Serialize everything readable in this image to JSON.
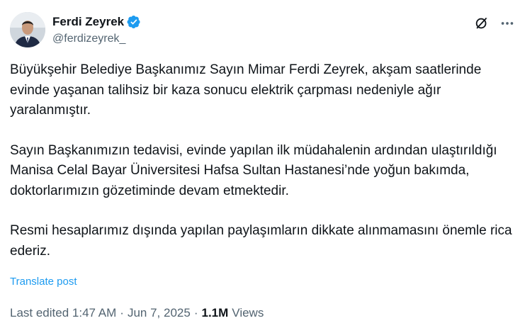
{
  "author": {
    "display_name": "Ferdi Zeyrek",
    "handle": "@ferdizeyrek_",
    "verified": true,
    "verified_color": "#1d9bf0"
  },
  "header_icons": [
    "grok-icon",
    "more-icon"
  ],
  "post": {
    "paragraphs": [
      "Büyükşehir Belediye Başkanımız Sayın Mimar Ferdi Zeyrek, akşam saatlerinde evinde yaşanan talihsiz bir kaza sonucu elektrik çarpması nedeniyle ağır yaralanmıştır.",
      "Sayın Başkanımızın tedavisi, evinde yapılan ilk müdahalenin ardından ulaştırıldığı Manisa Celal Bayar Üniversitesi Hafsa Sultan Hastanesi’nde yoğun bakımda, doktorlarımızın gözetiminde devam etmektedir.",
      "Resmi hesaplarımız dışında yapılan paylaşımların dikkate alınmamasını önemle rica ederiz."
    ],
    "translate_label": "Translate post"
  },
  "meta": {
    "edited_time": "Last edited 1:47 AM",
    "date": "Jun 7, 2025",
    "separator": "·",
    "views_count": "1.1M",
    "views_label": "Views"
  },
  "colors": {
    "text": "#0f1419",
    "secondary": "#536471",
    "link": "#1d9bf0"
  }
}
